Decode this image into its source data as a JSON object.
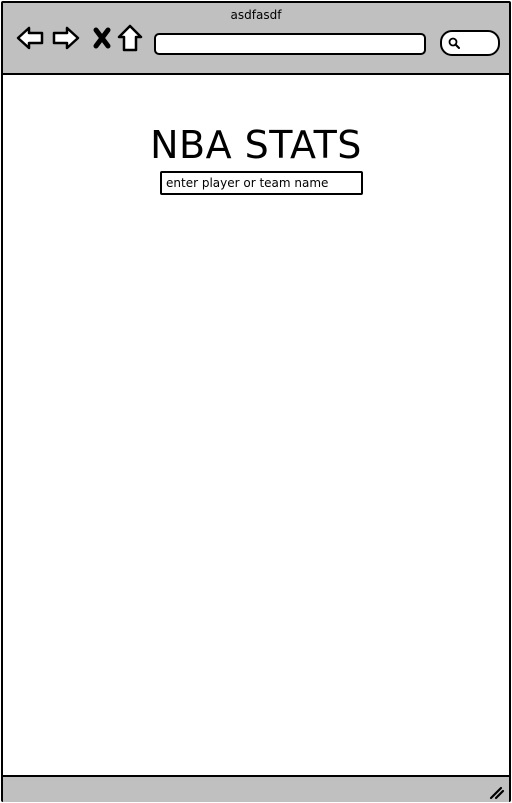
{
  "window": {
    "title": "asdfasdf"
  },
  "toolbar": {
    "back_icon": "arrow-left-icon",
    "forward_icon": "arrow-right-icon",
    "stop_icon": "close-icon",
    "home_icon": "home-icon",
    "address_value": "",
    "search_icon": "search-icon"
  },
  "main": {
    "title": "NBA STATS",
    "search": {
      "placeholder": "enter player or team name",
      "value": ""
    }
  },
  "statusbar": {
    "grip_icon": "resize-grip-icon"
  },
  "colors": {
    "chrome": "#c0c0c0",
    "background": "#ffffff",
    "stroke": "#000000"
  }
}
